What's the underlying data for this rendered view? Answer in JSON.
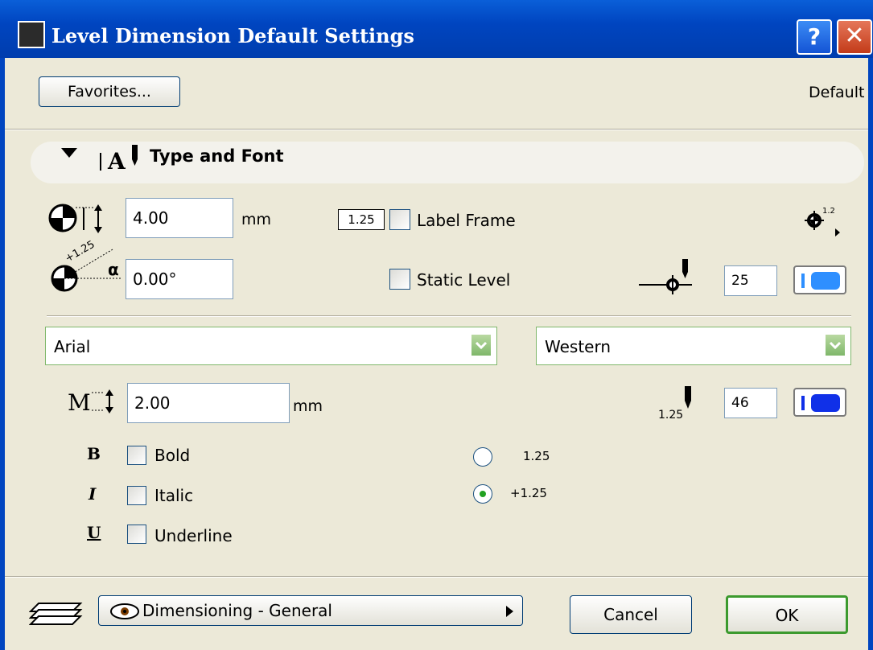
{
  "window": {
    "title": "Level Dimension Default Settings",
    "help_label": "?",
    "close_label": "✕"
  },
  "header": {
    "favorites_label": "Favorites...",
    "default_label": "Default"
  },
  "panel": {
    "title": "Type and Font"
  },
  "marker": {
    "size_value": "4.00",
    "size_unit": "mm",
    "angle_value": "0.00°"
  },
  "label_frame": {
    "badge": "1.25",
    "label": "Label Frame",
    "checked": false
  },
  "static_level": {
    "label": "Static Level",
    "checked": false
  },
  "marker_pen": {
    "value": "25",
    "color": "#2e8fff"
  },
  "font": {
    "family": "Arial",
    "script": "Western",
    "size_value": "2.00",
    "size_unit": "mm"
  },
  "text_pen": {
    "prefix": "1.25",
    "value": "46",
    "color": "#1030e8"
  },
  "style": {
    "bold_glyph": "B",
    "bold_label": "Bold",
    "italic_glyph": "I",
    "italic_label": "Italic",
    "underline_glyph": "U",
    "underline_label": "Underline"
  },
  "format": {
    "option1": "1.25",
    "option2": "+1.25",
    "selected": "+1.25"
  },
  "marker_icon": {
    "sup": "1.2",
    "angle_marker": "+1.25",
    "alpha": "α"
  },
  "footer": {
    "layer_value": "Dimensioning - General",
    "cancel_label": "Cancel",
    "ok_label": "OK"
  },
  "colors": {
    "titlebar": "#0045c0",
    "dialog_bg": "#ece9d8",
    "accent_green": "#7fb76a"
  },
  "icons": [
    "app-icon",
    "help-icon",
    "close-icon",
    "collapse-triangle-icon",
    "type-font-icon",
    "marker-size-icon",
    "marker-angle-icon",
    "marker-type-icon",
    "pen-icon",
    "text-size-icon",
    "layer-icon",
    "eye-icon"
  ]
}
